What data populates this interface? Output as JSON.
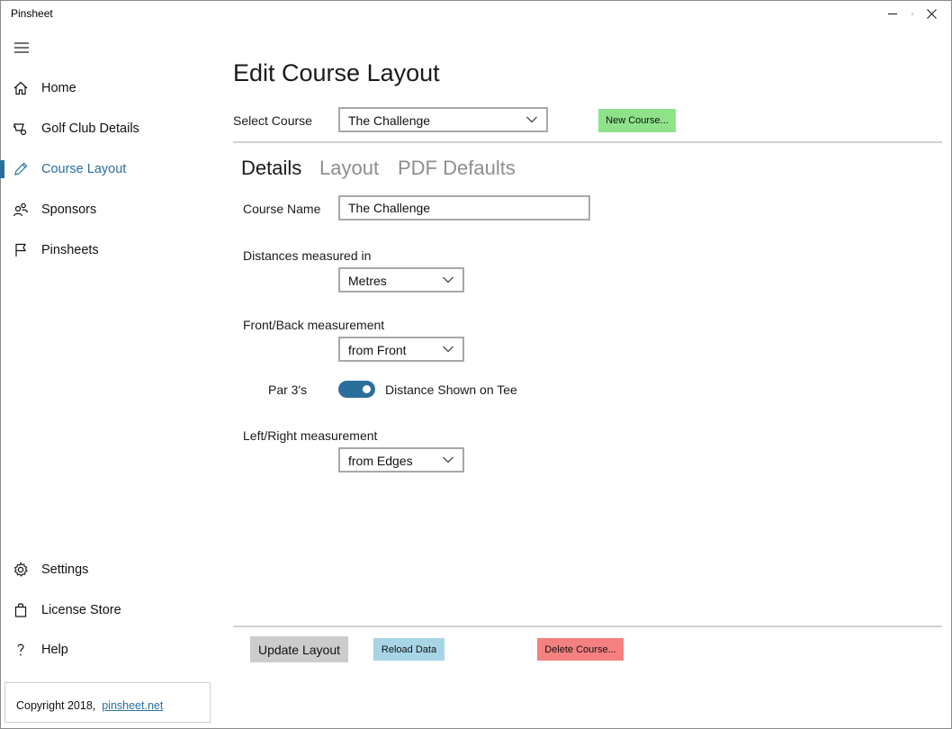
{
  "app": {
    "title": "Pinsheet"
  },
  "nav": {
    "items": [
      {
        "label": "Home",
        "icon": "home-icon"
      },
      {
        "label": "Golf Club Details",
        "icon": "golf-cart-icon"
      },
      {
        "label": "Course Layout",
        "icon": "pencil-icon",
        "active": true
      },
      {
        "label": "Sponsors",
        "icon": "people-icon"
      },
      {
        "label": "Pinsheets",
        "icon": "flag-icon"
      }
    ],
    "bottom_items": [
      {
        "label": "Settings",
        "icon": "gear-icon"
      },
      {
        "label": "License Store",
        "icon": "shopping-bag-icon"
      },
      {
        "label": "Help",
        "icon": "question-icon"
      }
    ],
    "copyright": {
      "text": "Copyright 2018,",
      "link": "pinsheet.net"
    }
  },
  "page": {
    "title": "Edit Course Layout",
    "select_course": {
      "label": "Select Course",
      "value": "The Challenge"
    },
    "new_course_button": "New Course...",
    "tabs": [
      {
        "label": "Details",
        "active": true
      },
      {
        "label": "Layout",
        "active": false
      },
      {
        "label": "PDF Defaults",
        "active": false
      }
    ],
    "details": {
      "course_name": {
        "label": "Course Name",
        "value": "The Challenge"
      },
      "distances": {
        "label": "Distances measured in",
        "value": "Metres"
      },
      "front_back": {
        "label": "Front/Back measurement",
        "value": "from Front"
      },
      "par3": {
        "label": "Par 3's",
        "toggle_text": "Distance Shown on Tee",
        "on": true
      },
      "left_right": {
        "label": "Left/Right measurement",
        "value": "from Edges"
      }
    },
    "footer": {
      "update_button": "Update Layout",
      "reload_button": "Reload Data",
      "delete_button": "Delete Course..."
    }
  },
  "colors": {
    "accent": "#2a6f9c",
    "new_button": "#8ee38a",
    "reload_button": "#a7d5e6",
    "delete_button": "#f48080",
    "update_button": "#cccccc"
  }
}
